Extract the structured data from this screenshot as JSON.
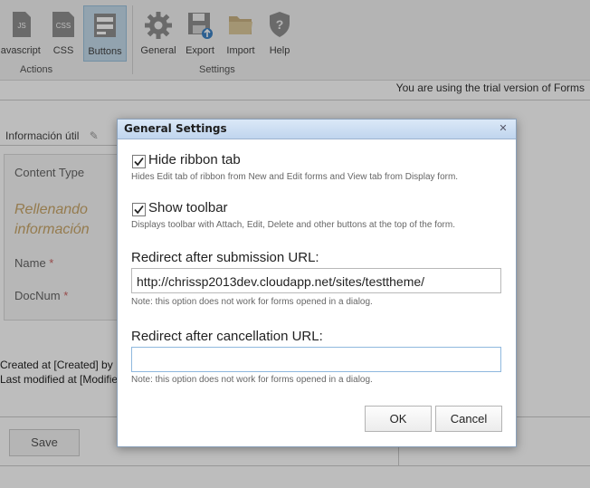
{
  "ribbon": {
    "buttons": [
      {
        "label": "Javascript",
        "icon": "js-file-icon",
        "badge": "JS"
      },
      {
        "label": "CSS",
        "icon": "css-file-icon",
        "badge": "CSS"
      },
      {
        "label": "Buttons",
        "icon": "buttons-icon",
        "active": true
      },
      {
        "label": "General",
        "icon": "gear-icon"
      },
      {
        "label": "Export",
        "icon": "export-disk-icon"
      },
      {
        "label": "Import",
        "icon": "folder-icon"
      },
      {
        "label": "Help",
        "icon": "help-shield-icon"
      }
    ],
    "groups": {
      "actions": "Actions",
      "settings": "Settings"
    }
  },
  "page": {
    "trial_notice": "You are using the trial version of Forms",
    "section_title": "Información útil",
    "fields": {
      "content_type": "Content Type",
      "name": "Name",
      "docnum": "DocNum",
      "placeholder_text_1": "Rellenando",
      "placeholder_text_2": "información"
    },
    "created": "Created at [Created] by [",
    "modified": "Last modified at [Modifie",
    "save_label": "Save"
  },
  "dialog": {
    "title": "General Settings",
    "hide_ribbon": {
      "label": "Hide ribbon tab",
      "checked": true,
      "hint": "Hides Edit tab of ribbon from New and Edit forms and View tab from Display form."
    },
    "show_toolbar": {
      "label": "Show toolbar",
      "checked": true,
      "hint": "Displays toolbar with Attach, Edit, Delete and other buttons at the top of the form."
    },
    "redirect_submit": {
      "label": "Redirect after submission URL:",
      "value": "http://chrissp2013dev.cloudapp.net/sites/testtheme/",
      "note": "Note: this option does not work for forms opened in a dialog."
    },
    "redirect_cancel": {
      "label": "Redirect after cancellation URL:",
      "value": "",
      "note": "Note: this option does not work for forms opened in a dialog."
    },
    "ok_label": "OK",
    "cancel_label": "Cancel"
  },
  "colors": {
    "titlebar": "#c0d5ee",
    "active_ribbon": "#c5dcec",
    "overlay": "rgba(0,0,0,0.26)"
  }
}
